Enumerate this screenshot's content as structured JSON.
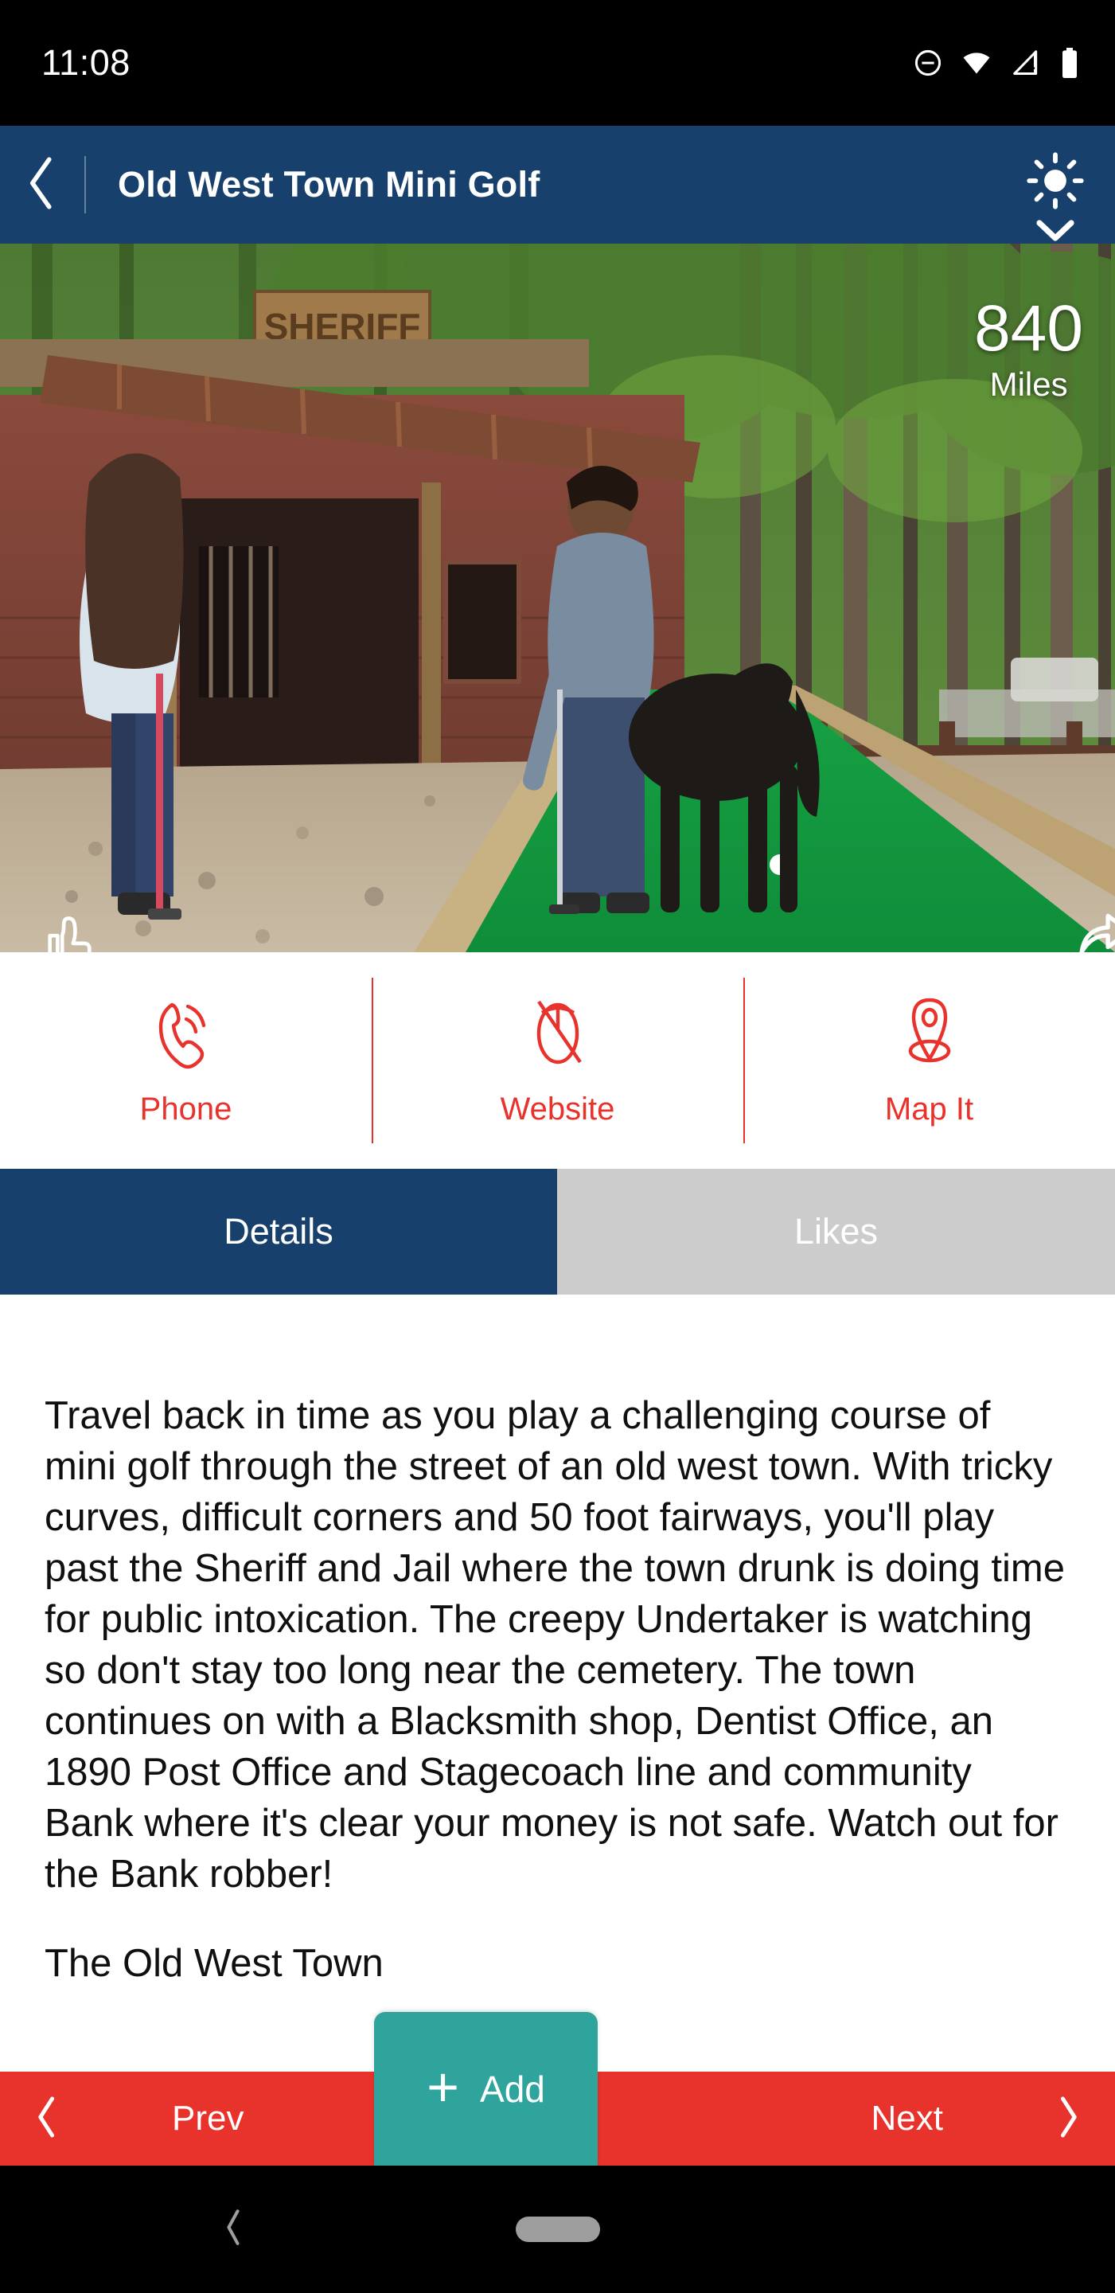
{
  "status_bar": {
    "time": "11:08",
    "icons": [
      "do-not-disturb-icon",
      "wifi-icon",
      "cell-signal-alert-icon",
      "battery-icon"
    ]
  },
  "app_bar": {
    "back_label": "back-chevron-icon",
    "title": "Old West Town Mini Golf",
    "weather_icon": "sun-icon",
    "expand_icon": "chevron-down-icon"
  },
  "hero": {
    "distance_value": "840",
    "distance_unit": "Miles",
    "like_icon": "thumbs-up-icon",
    "share_icon": "share-icon",
    "alt": "Mini golf course with old west sheriff building, woman with putter and man with horse"
  },
  "actions": [
    {
      "label": "Phone",
      "icon": "phone-icon"
    },
    {
      "label": "Website",
      "icon": "mouse-icon"
    },
    {
      "label": "Map It",
      "icon": "map-pin-icon"
    }
  ],
  "tabs": [
    {
      "label": "Details",
      "active": true
    },
    {
      "label": "Likes",
      "active": false
    }
  ],
  "details": {
    "description": "Travel back in time as you play a challenging course of mini golf through the street of an old west town. With tricky curves, difficult corners and 50 foot fairways, you'll play past the Sheriff and Jail where the town drunk is doing time for public intoxication. The creepy Undertaker is watching so don't stay too long near the cemetery. The town continues on with a Blacksmith shop, Dentist Office, an 1890 Post Office and Stagecoach line and community Bank where it's clear your money is not safe. Watch out for the Bank robber!",
    "next_paragraph_clipped": "The Old West Town"
  },
  "bottom_bar": {
    "prev_label": "Prev",
    "prev_icon": "chevron-left-icon",
    "add_label": "Add",
    "add_icon": "plus-icon",
    "next_label": "Next",
    "next_icon": "chevron-right-icon"
  },
  "android_nav": {
    "back_icon": "nav-back-icon",
    "home_icon": "nav-home-pill"
  },
  "colors": {
    "brand_blue": "#17406c",
    "accent_red": "#e8322c",
    "add_teal": "#2fa49c",
    "tab_inactive": "#cccccc",
    "status_bg": "#000000"
  }
}
